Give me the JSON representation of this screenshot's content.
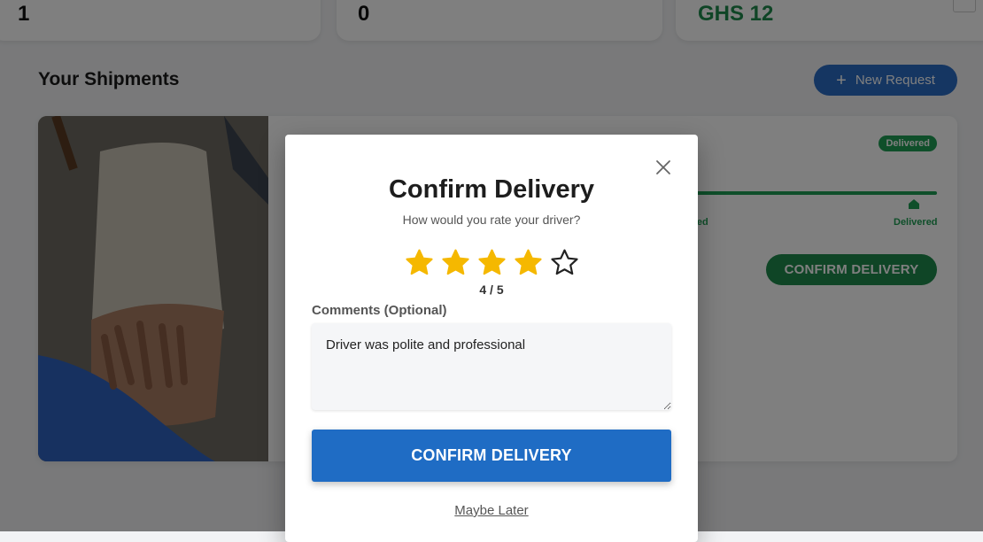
{
  "stats": {
    "card1_value": "1",
    "card2_value": "0",
    "card3_value": "GHS 12",
    "card1_icon": "truck-icon",
    "card2_icon": "clock-icon"
  },
  "section": {
    "title": "Your Shipments",
    "new_request_label": "New Request"
  },
  "shipment": {
    "status": "Delivered",
    "steps": [
      {
        "label": "aded",
        "icon": "truck-icon"
      },
      {
        "label": "Delivered",
        "icon": "home-icon"
      }
    ],
    "confirm_label": "CONFIRM DELIVERY",
    "photo": "sack-of-cassava-photo"
  },
  "modal": {
    "title": "Confirm Delivery",
    "subtitle": "How would you rate your driver?",
    "rating": 4,
    "rating_max": 5,
    "rating_text": "4 / 5",
    "comments_label": "Comments (Optional)",
    "comments_value": "Driver was polite and professional",
    "confirm_label": "CONFIRM DELIVERY",
    "maybe_later": "Maybe Later"
  },
  "colors": {
    "primary": "#1f6cc4",
    "success": "#1f9e55",
    "star_filled": "#f5b800"
  }
}
